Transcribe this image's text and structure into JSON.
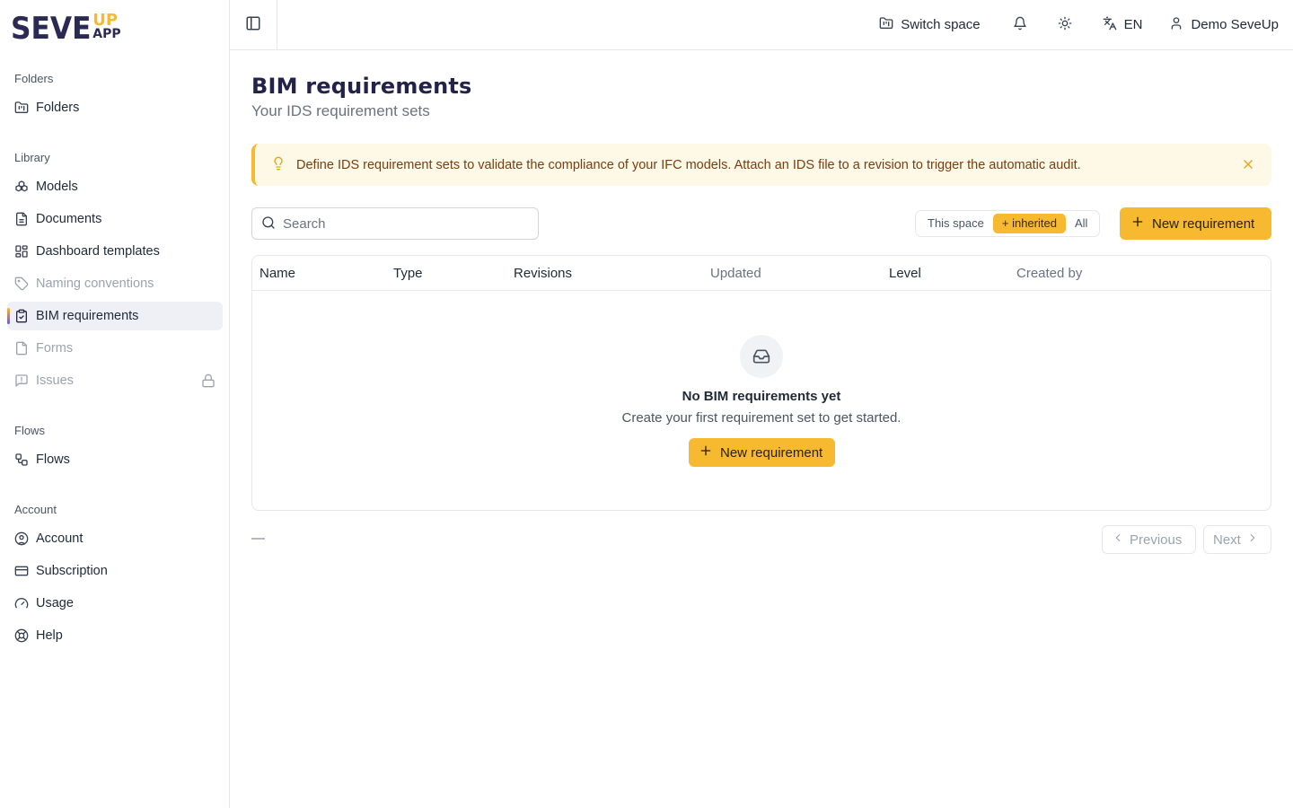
{
  "brand": {
    "main": "SEVE",
    "up": "UP",
    "app": "APP"
  },
  "sidebar": {
    "sections": [
      {
        "title": "Folders",
        "items": [
          {
            "label": "Folders",
            "icon": "folder-icon"
          }
        ]
      },
      {
        "title": "Library",
        "items": [
          {
            "label": "Models",
            "icon": "cubes-icon"
          },
          {
            "label": "Documents",
            "icon": "file-icon"
          },
          {
            "label": "Dashboard templates",
            "icon": "dashboard-icon"
          },
          {
            "label": "Naming conventions",
            "icon": "tag-icon"
          },
          {
            "label": "BIM requirements",
            "icon": "clipboard-check-icon"
          },
          {
            "label": "Forms",
            "icon": "form-icon"
          },
          {
            "label": "Issues",
            "icon": "message-alert-icon"
          }
        ]
      },
      {
        "title": "Flows",
        "items": [
          {
            "label": "Flows",
            "icon": "workflow-icon"
          }
        ]
      },
      {
        "title": "Account",
        "items": [
          {
            "label": "Account",
            "icon": "user-circle-icon"
          },
          {
            "label": "Subscription",
            "icon": "card-icon"
          },
          {
            "label": "Usage",
            "icon": "gauge-icon"
          },
          {
            "label": "Help",
            "icon": "lifebuoy-icon"
          }
        ]
      }
    ]
  },
  "header": {
    "switch_space": "Switch space",
    "language": "EN",
    "user": "Demo SeveUp"
  },
  "page": {
    "title": "BIM requirements",
    "subtitle": "Your IDS requirement sets",
    "alert": "Define IDS requirement sets to validate the compliance of your IFC models. Attach an IDS file to a revision to trigger the automatic audit.",
    "search_placeholder": "Search",
    "scope": {
      "this_space": "This space",
      "inherited": "+ inherited",
      "all": "All",
      "selected": "inherited"
    },
    "new_button": "New requirement"
  },
  "table": {
    "columns": [
      "Name",
      "Type",
      "Revisions",
      "Updated",
      "Level",
      "Created by"
    ],
    "empty": {
      "title": "No BIM requirements yet",
      "subtitle": "Create your first requirement set to get started.",
      "button": "New requirement"
    }
  },
  "pager": {
    "info": "—",
    "previous": "Previous",
    "next": "Next"
  },
  "colors": {
    "accent": "#f6b930",
    "brand": "#2a2a55",
    "alert_bg": "#fef9e7",
    "alert_text": "#7a3d10"
  }
}
